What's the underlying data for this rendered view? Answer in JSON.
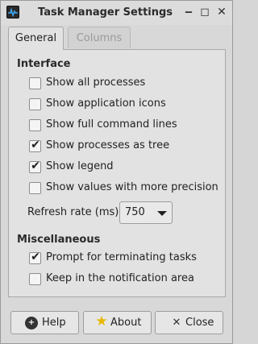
{
  "window": {
    "title": "Task Manager Settings",
    "icon": "task-manager-icon",
    "controls": {
      "minimize": "‒",
      "maximize": "◻",
      "close": "✕"
    }
  },
  "tabs": [
    {
      "label": "General",
      "active": true
    },
    {
      "label": "Columns",
      "active": false
    }
  ],
  "interface": {
    "heading": "Interface",
    "options": [
      {
        "label": "Show all processes",
        "checked": false
      },
      {
        "label": "Show application icons",
        "checked": false
      },
      {
        "label": "Show full command lines",
        "checked": false
      },
      {
        "label": "Show processes as tree",
        "checked": true
      },
      {
        "label": "Show legend",
        "checked": true
      },
      {
        "label": "Show values with more precision",
        "checked": false
      }
    ],
    "refresh_label": "Refresh rate (ms):",
    "refresh_value": "750"
  },
  "misc": {
    "heading": "Miscellaneous",
    "options": [
      {
        "label": "Prompt for terminating tasks",
        "checked": true
      },
      {
        "label": "Keep in the notification area",
        "checked": false
      }
    ]
  },
  "buttons": {
    "help": "Help",
    "about": "About",
    "close": "Close",
    "help_icon": "help-icon",
    "about_icon": "star-icon",
    "close_icon": "close-icon"
  },
  "check_mark": "✔"
}
